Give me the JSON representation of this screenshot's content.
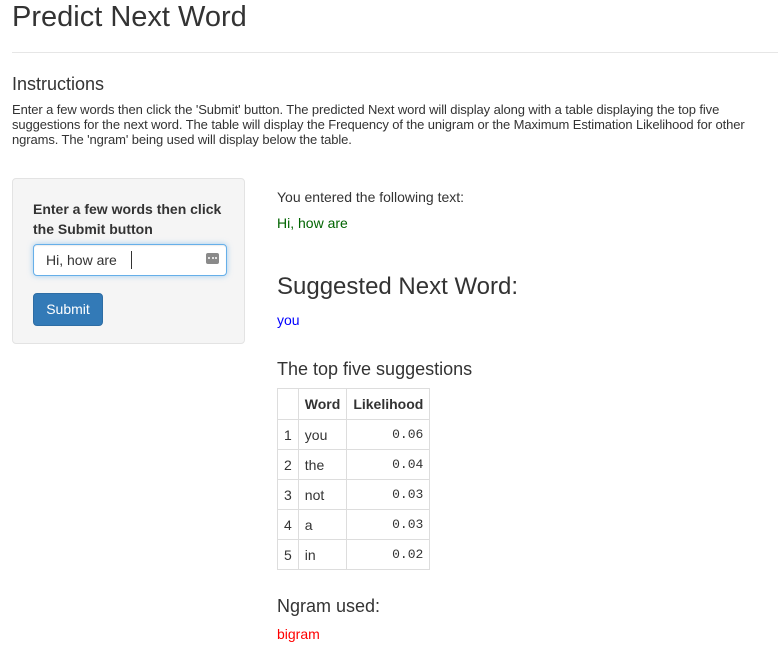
{
  "page": {
    "title": "Predict Next Word"
  },
  "instructions": {
    "heading": "Instructions",
    "text": "Enter a few words then click the 'Submit' button. The predicted Next word will display along with a table displaying the top five suggestions for the next word. The table will display the Frequency of the unigram or the Maximum Estimation Likelihood for other ngrams. The 'ngram' being used will display below the table."
  },
  "sidebar": {
    "label": "Enter a few words then click the Submit button",
    "input_value": "Hi, how are",
    "input_icon": "more-dots-icon",
    "submit_label": "Submit",
    "submit_color": "#337ab7"
  },
  "main": {
    "entered_label": "You entered the following text:",
    "entered_text": "Hi, how are",
    "entered_color": "#006400",
    "suggested_heading": "Suggested Next Word:",
    "suggested_word": "you",
    "suggested_color": "#0000ff",
    "top_heading": "The top five suggestions",
    "table": {
      "headers": [
        "",
        "Word",
        "Likelihood"
      ],
      "rows": [
        {
          "index": "1",
          "word": "you",
          "likelihood": "0.06"
        },
        {
          "index": "2",
          "word": "the",
          "likelihood": "0.04"
        },
        {
          "index": "3",
          "word": "not",
          "likelihood": "0.03"
        },
        {
          "index": "4",
          "word": "a",
          "likelihood": "0.03"
        },
        {
          "index": "5",
          "word": "in",
          "likelihood": "0.02"
        }
      ]
    },
    "ngram_heading": "Ngram used:",
    "ngram_value": "bigram",
    "ngram_color": "#ff0000"
  }
}
